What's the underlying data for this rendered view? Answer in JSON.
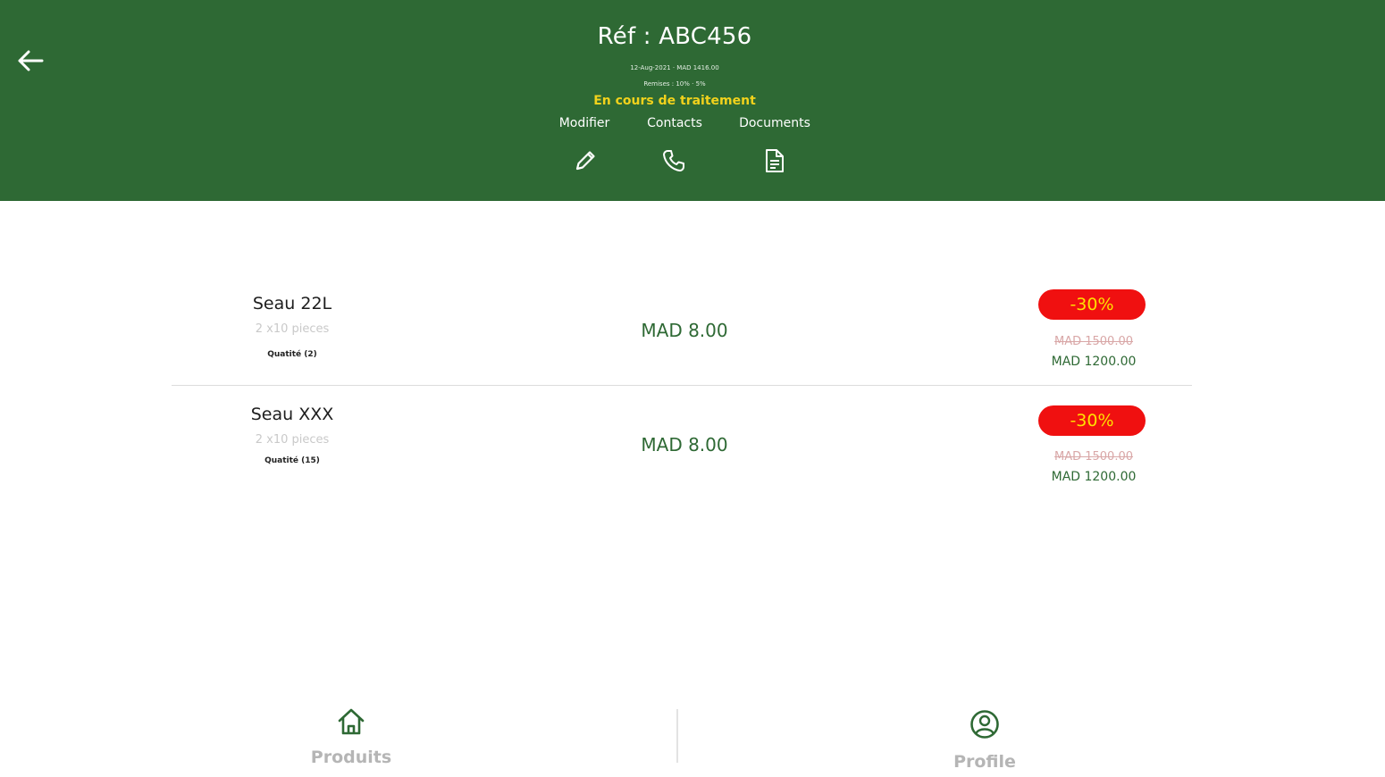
{
  "header": {
    "title": "Réf : ABC456",
    "meta_line1": "12-Aug-2021 · MAD 1416.00",
    "meta_line2": "Remises : 10% · 5%",
    "status": "En cours de traitement",
    "actions": [
      {
        "label": "Modifier",
        "icon": "pencil-icon"
      },
      {
        "label": "Contacts",
        "icon": "phone-icon"
      },
      {
        "label": "Documents",
        "icon": "document-icon"
      }
    ]
  },
  "products": [
    {
      "name": "Seau 22L",
      "pack": "2 x10 pieces",
      "quantity": "Quatité (2)",
      "unit_price": "MAD 8.00",
      "discount": "-30%",
      "old_price": "MAD 1500.00",
      "new_price": "MAD 1200.00"
    },
    {
      "name": "Seau XXX",
      "pack": "2 x10 pieces",
      "quantity": "Quatité (15)",
      "unit_price": "MAD 8.00",
      "discount": "-30%",
      "old_price": "MAD 1500.00",
      "new_price": "MAD 1200.00"
    }
  ],
  "bottom_nav": [
    {
      "label": "Produits",
      "icon": "home-icon"
    },
    {
      "label": "Profile",
      "icon": "user-circle-icon"
    }
  ],
  "colors": {
    "header_bg": "#2e6934",
    "status": "#f2d21c",
    "badge_bg": "#f01010",
    "badge_text": "#ffe000"
  }
}
